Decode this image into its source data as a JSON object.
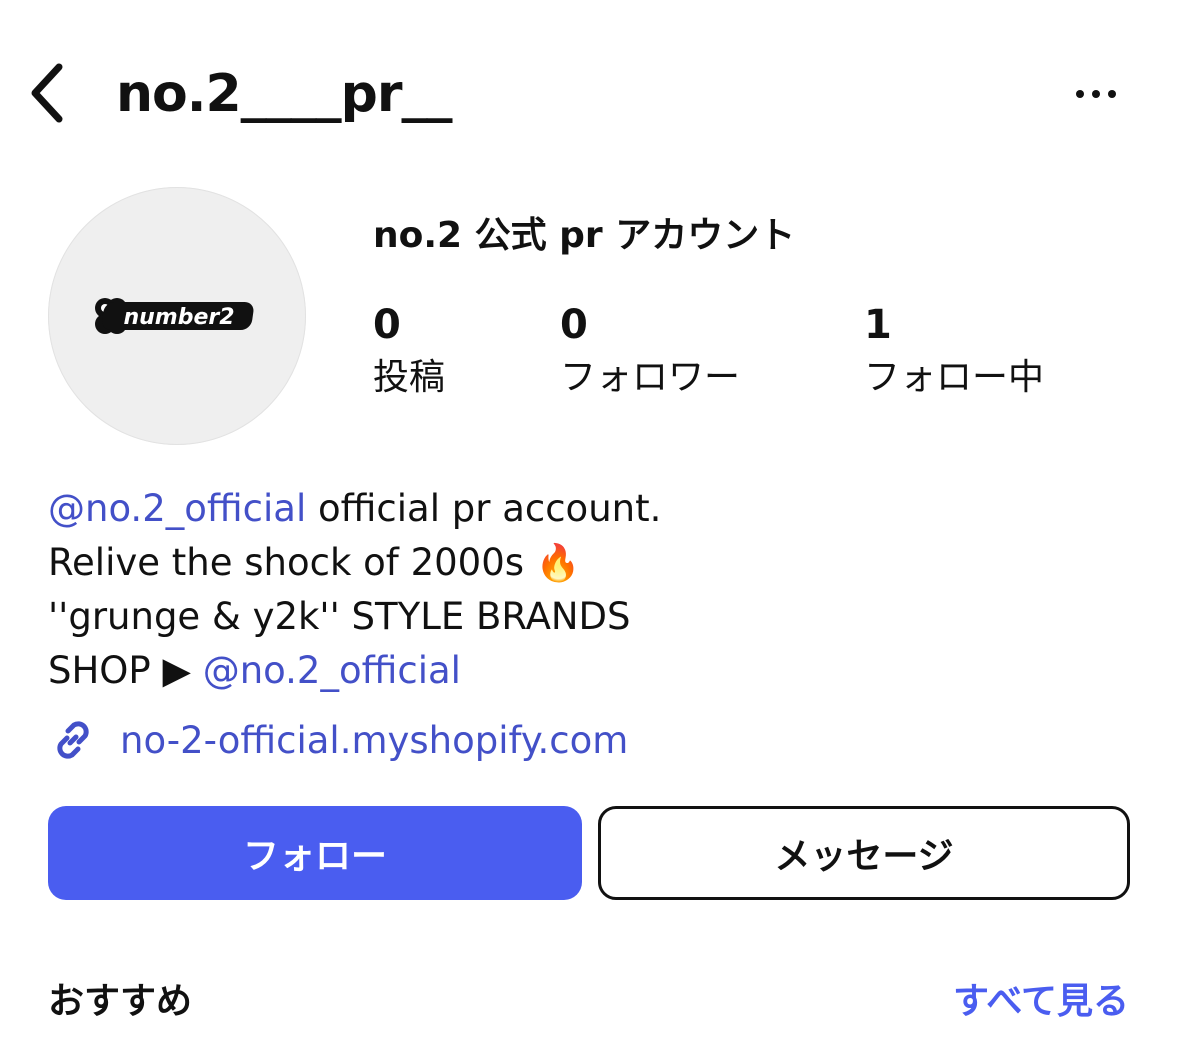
{
  "header": {
    "username": "no.2____pr__",
    "back_icon": "chevron-left-icon",
    "more_icon": "ellipsis-horizontal-icon"
  },
  "profile": {
    "avatar_logo": "number2",
    "display_name": "no.2 公式 pr アカウント",
    "stats": [
      {
        "count": "0",
        "label": "投稿"
      },
      {
        "count": "0",
        "label": "フォロワー"
      },
      {
        "count": "1",
        "label": "フォロー中"
      }
    ]
  },
  "bio": {
    "line1_mention": "@no.2_official",
    "line1_text": " official pr account.",
    "line2_text": "Relive the shock of 2000s ",
    "line2_emoji": "🔥",
    "line3_text": "''grunge & y2k'' STYLE BRANDS",
    "line4_text": "SHOP ▶ ",
    "line4_mention": "@no.2_official"
  },
  "link": {
    "icon": "link-icon",
    "text": "no-2-official.myshopify.com"
  },
  "actions": {
    "follow_label": "フォロー",
    "message_label": "メッセージ"
  },
  "recommended": {
    "title": "おすすめ",
    "see_all_label": "すべて見る"
  },
  "colors": {
    "accent": "#4a5df0",
    "link": "#4350c8",
    "text": "#111111"
  }
}
